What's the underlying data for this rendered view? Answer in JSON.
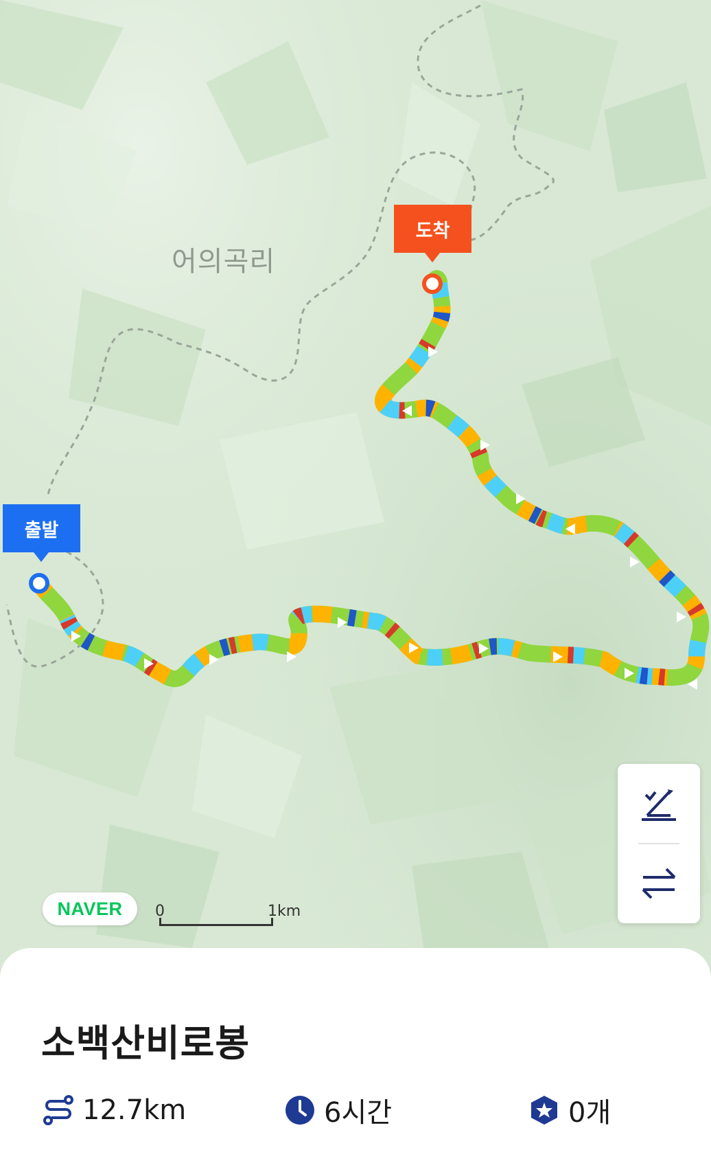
{
  "map": {
    "place_label": "어의곡리",
    "start_marker": "출발",
    "end_marker": "도착",
    "logo": "NAVER",
    "scale": {
      "start": "0",
      "end": "1km"
    },
    "controls": [
      {
        "icon": "elevation-toggle-icon"
      },
      {
        "icon": "swap-direction-icon"
      }
    ],
    "colors": {
      "start": "#1c6ff0",
      "end": "#f4511e",
      "route_segments": [
        "#8fd63f",
        "#ffb300",
        "#4dd0f7",
        "#d63a2a",
        "#1f56c8"
      ]
    }
  },
  "trail": {
    "name": "소백산비로봉",
    "stats": [
      {
        "icon": "route-distance-icon",
        "value": "12.7km"
      },
      {
        "icon": "clock-icon",
        "value": "6시간"
      },
      {
        "icon": "badge-star-icon",
        "value": "0개"
      }
    ]
  }
}
